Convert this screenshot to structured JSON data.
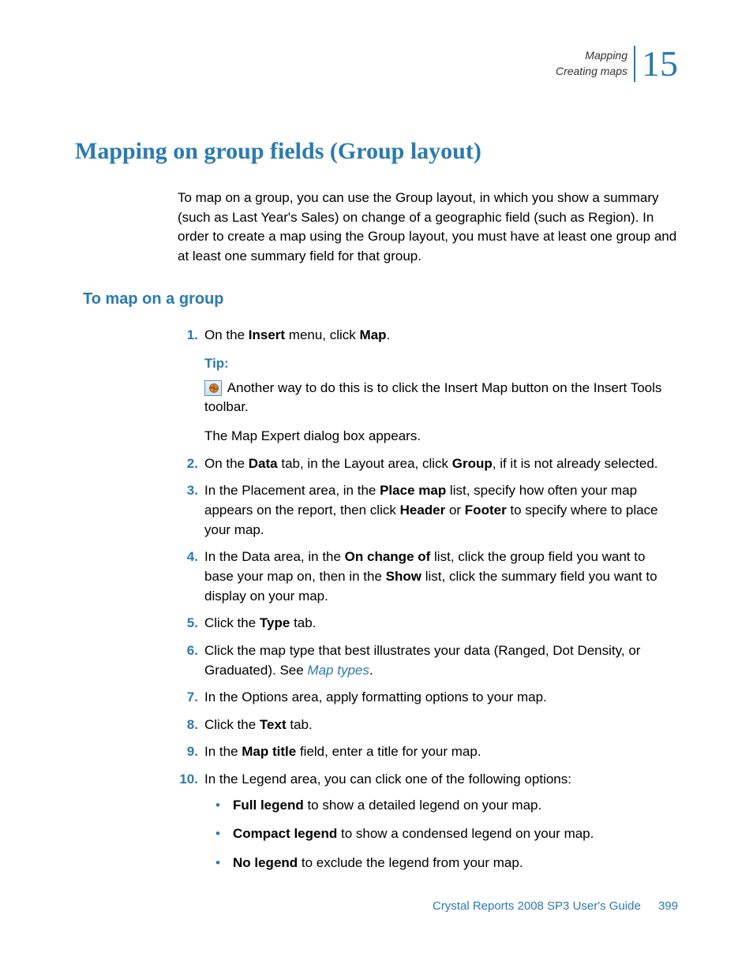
{
  "header": {
    "line1": "Mapping",
    "line2": "Creating maps",
    "chapter": "15"
  },
  "h1": "Mapping on group fields (Group layout)",
  "intro": "To map on a group, you can use the Group layout, in which you show a summary (such as Last Year's Sales) on change of a geographic field (such as Region). In order to create a map using the Group layout, you must have at least one group and at least one summary field for that group.",
  "h2": "To map on a group",
  "steps": {
    "s1": {
      "pre": "On the ",
      "b1": "Insert",
      "mid": " menu, click ",
      "b2": "Map",
      "post": "."
    },
    "tipLabel": "Tip:",
    "tipText": " Another way to do this is to click the Insert Map button on the Insert Tools toolbar.",
    "s1extra": "The Map Expert dialog box appears.",
    "s2": {
      "pre": "On the ",
      "b1": "Data",
      "mid": " tab, in the Layout area, click ",
      "b2": "Group",
      "post": ", if it is not already selected."
    },
    "s3": {
      "pre": "In the Placement area, in the ",
      "b1": "Place map",
      "mid1": " list, specify how often your map appears on the report, then click ",
      "b2": "Header",
      "mid2": " or ",
      "b3": "Footer",
      "post": " to specify where to place your map."
    },
    "s4": {
      "pre": "In the Data area, in the ",
      "b1": "On change of",
      "mid1": " list, click the group field you want to base your map on, then in the ",
      "b2": "Show",
      "post": " list, click the summary field you want to display on your map."
    },
    "s5": {
      "pre": "Click the ",
      "b1": "Type",
      "post": " tab."
    },
    "s6": {
      "pre": "Click the map type that best illustrates your data (Ranged, Dot Density, or Graduated). See ",
      "link": "Map types",
      "post": "."
    },
    "s7": "In the Options area, apply formatting options to your map.",
    "s8": {
      "pre": "Click the ",
      "b1": "Text",
      "post": " tab."
    },
    "s9": {
      "pre": "In the ",
      "b1": "Map title",
      "post": " field, enter a title for your map."
    },
    "s10": "In the Legend area, you can click one of the following options:",
    "bullets": {
      "b1": {
        "bold": "Full legend",
        "rest": " to show a detailed legend on your map."
      },
      "b2": {
        "bold": "Compact legend",
        "rest": " to show a condensed legend on your map."
      },
      "b3": {
        "bold": "No legend",
        "rest": " to exclude the legend from your map."
      }
    }
  },
  "footer": {
    "title": "Crystal Reports 2008 SP3 User's Guide",
    "page": "399"
  }
}
